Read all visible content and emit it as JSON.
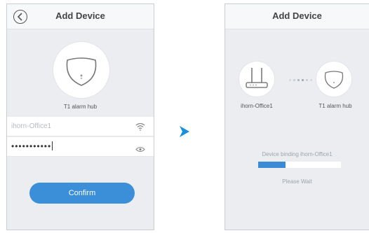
{
  "left_screen": {
    "title": "Add Device",
    "device_name": "T1 alarm hub",
    "wifi_name": "ihorn-Office1",
    "password_mask": "•••••••••••",
    "confirm_label": "Confirm"
  },
  "right_screen": {
    "title": "Add Device",
    "router_name": "ihorn-Office1",
    "device_name": "T1 alarm hub",
    "status_text": "Device binding ihorn-Office1",
    "progress_fraction": 0.33,
    "wait_text": "Please Wait"
  },
  "icons": [
    "back-arrow-icon",
    "hub-icon",
    "wifi-icon",
    "eye-icon",
    "next-arrow-icon",
    "router-icon"
  ],
  "colors": {
    "accent": "#3b8fd8",
    "background": "#ebedf0",
    "arrow": "#1a8fe0"
  }
}
